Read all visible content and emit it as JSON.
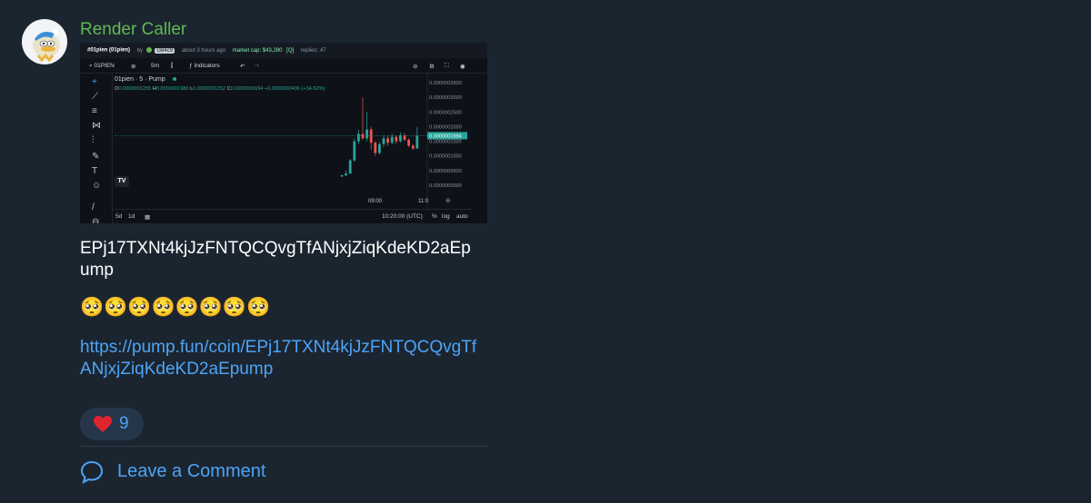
{
  "message": {
    "sender_name": "Render Caller",
    "contract_address": "EPj17TXNt4kjJzFNTQCQvgTfANjxjZiqKdeKD2aEpump",
    "emojis": "🥺🥺🥺🥺🥺🥺🥺🥺",
    "link": "https://pump.fun/coin/EPj17TXNt4kjJzFNTQCQvgTfANjxjZiqKdeKD2aEpump",
    "reaction": {
      "emoji": "heart-icon",
      "count": "9"
    },
    "comment_label": "Leave a Comment"
  },
  "screenshot": {
    "header": {
      "ticker": "#01pien (01pien)",
      "by": "by",
      "user_badge": "G84c9",
      "posted": "about 3 hours ago",
      "market_cap": "market cap: $43,280",
      "replies": "replies: 47"
    },
    "toolbar": {
      "symbol": "01PIEN",
      "interval": "5m",
      "indicators": "Indicators"
    },
    "legend": {
      "title": "01pien · 5 · Pump",
      "o_label": "O",
      "o": "0.0000001255",
      "h_label": "H",
      "h": "0.0000001980",
      "l_label": "L",
      "l": "0.0000001252",
      "c_label": "C",
      "c": "0.0000001694",
      "change": "+0.0000000436 (+34.62%)"
    },
    "bottom": {
      "range1": "5d",
      "range2": "1d",
      "time": "10:20:00 (UTC)",
      "pct": "%",
      "log": "log",
      "auto": "auto"
    },
    "tv_logo": "TV",
    "colors": {
      "up": "#26a69a",
      "down": "#ef5350",
      "background": "#0e1218"
    },
    "chart_data": {
      "type": "candlestick",
      "title": "01pien · 5 · Pump",
      "xlabel": "",
      "ylabel": "",
      "ylim": [
        0,
        3.5e-07
      ],
      "y_ticks": [
        "0.0000003500",
        "0.0000003000",
        "0.0000002500",
        "0.0000002000",
        "0.0000001500",
        "0.0000001000",
        "0.0000000500",
        "0.0000000000"
      ],
      "x_ticks": [
        "09:00",
        "11:0"
      ],
      "last_price_label": "0.0000001694",
      "candles": [
        {
          "t": "08:50",
          "o": 3e-08,
          "c": 3.4e-08,
          "h": 3.6e-08,
          "l": 2.8e-08
        },
        {
          "t": "08:55",
          "o": 3.4e-08,
          "c": 4e-08,
          "h": 5e-08,
          "l": 3.2e-08
        },
        {
          "t": "09:00",
          "o": 4e-08,
          "c": 8.5e-08,
          "h": 9e-08,
          "l": 3.8e-08
        },
        {
          "t": "09:05",
          "o": 8.5e-08,
          "c": 1.5e-07,
          "h": 1.6e-07,
          "l": 8e-08
        },
        {
          "t": "09:10",
          "o": 1.5e-07,
          "c": 1.75e-07,
          "h": 1.9e-07,
          "l": 1.4e-07
        },
        {
          "t": "09:15",
          "o": 1.75e-07,
          "c": 1.6e-07,
          "h": 3e-07,
          "l": 1.55e-07
        },
        {
          "t": "09:20",
          "o": 1.6e-07,
          "c": 1.9e-07,
          "h": 2.5e-07,
          "l": 1.5e-07
        },
        {
          "t": "09:25",
          "o": 1.9e-07,
          "c": 1.45e-07,
          "h": 2e-07,
          "l": 1.2e-07
        },
        {
          "t": "09:30",
          "o": 1.45e-07,
          "c": 1.1e-07,
          "h": 1.5e-07,
          "l": 1e-07
        },
        {
          "t": "09:35",
          "o": 1.1e-07,
          "c": 1.4e-07,
          "h": 1.48e-07,
          "l": 1.05e-07
        },
        {
          "t": "09:40",
          "o": 1.4e-07,
          "c": 1.6e-07,
          "h": 1.7e-07,
          "l": 1.3e-07
        },
        {
          "t": "09:45",
          "o": 1.6e-07,
          "c": 1.45e-07,
          "h": 1.7e-07,
          "l": 1.35e-07
        },
        {
          "t": "09:50",
          "o": 1.45e-07,
          "c": 1.65e-07,
          "h": 1.75e-07,
          "l": 1.4e-07
        },
        {
          "t": "09:55",
          "o": 1.65e-07,
          "c": 1.5e-07,
          "h": 1.7e-07,
          "l": 1.42e-07
        },
        {
          "t": "10:00",
          "o": 1.5e-07,
          "c": 1.7e-07,
          "h": 1.8e-07,
          "l": 1.45e-07
        },
        {
          "t": "10:05",
          "o": 1.7e-07,
          "c": 1.55e-07,
          "h": 1.78e-07,
          "l": 1.5e-07
        },
        {
          "t": "10:10",
          "o": 1.55e-07,
          "c": 1.35e-07,
          "h": 1.6e-07,
          "l": 1.3e-07
        },
        {
          "t": "10:15",
          "o": 1.35e-07,
          "c": 1.25e-07,
          "h": 1.4e-07,
          "l": 1.2e-07
        },
        {
          "t": "10:20",
          "o": 1.25e-07,
          "c": 1.69e-07,
          "h": 1.98e-07,
          "l": 1.25e-07
        }
      ]
    }
  }
}
